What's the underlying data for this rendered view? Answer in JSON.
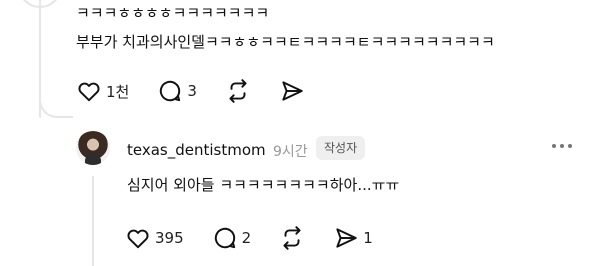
{
  "post": {
    "line1": "ㅋㅋㅋㅎㅎㅎㅎㅋㅋㅋㅋㅋㅋㅋ",
    "line2": "부부가 치과의사인델ㅋㅋㅎㅎㅋㅋㅌㅋㅋㅋㅋㅌㅋㅋㅋㅋㅋㅋㅋㅋㅋ",
    "like_count": "1천",
    "reply_count": "3"
  },
  "reply": {
    "username": "texas_dentistmom",
    "time": "9시간",
    "badge": "작성자",
    "text": "심지어 외아들 ㅋㅋㅋㅋㅋㅋㅋㅋ하아...ㅠㅠ",
    "like_count": "395",
    "reply_count": "2",
    "share_count": "1"
  },
  "icons": {
    "like": "heart-icon",
    "reply": "comment-icon",
    "repost": "repost-icon",
    "share": "send-icon",
    "more": "more-dots-icon"
  }
}
